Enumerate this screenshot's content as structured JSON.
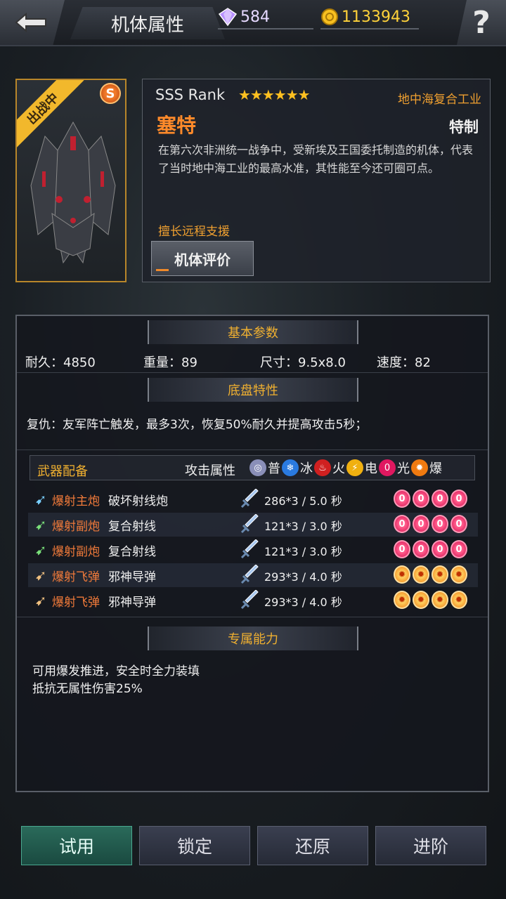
{
  "header": {
    "title": "机体属性",
    "gems": "584",
    "coins": "1133943",
    "help": "?"
  },
  "unit": {
    "deploy_status": "出战中",
    "rank_badge": "S",
    "rank": "SSS  Rank",
    "stars": "★★★★★★",
    "manufacturer": "地中海复合工业",
    "name": "塞特",
    "grade": "特制",
    "description": "在第六次非洲统一战争中，受新埃及王国委托制造的机体，代表了当时地中海工业的最高水准，其性能至今还可圈可点。",
    "specialty": "擅长远程支援",
    "eval_button": "机体评价"
  },
  "basic": {
    "header": "基本参数",
    "durability": "耐久：4850",
    "weight": "重量：89",
    "size": "尺寸：9.5x8.0",
    "speed": "速度：82"
  },
  "chassis": {
    "header": "底盘特性",
    "text": "复仇：友军阵亡触发，最多3次，恢复50%耐久并提高攻击5秒；"
  },
  "weapons": {
    "header": "武器配备",
    "attr_label": "攻击属性",
    "elements": [
      "普",
      "冰",
      "火",
      "电",
      "光",
      "爆"
    ],
    "rows": [
      {
        "type": "爆射主炮",
        "name": "破坏射线炮",
        "damage": "286*3  / 5.0 秒",
        "element": "light",
        "icon_color": "#7ad0ff"
      },
      {
        "type": "爆射副炮",
        "name": "复合射线",
        "damage": "121*3  / 3.0 秒",
        "element": "light",
        "icon_color": "#7ae07a"
      },
      {
        "type": "爆射副炮",
        "name": "复合射线",
        "damage": "121*3  / 3.0 秒",
        "element": "light",
        "icon_color": "#7ae07a"
      },
      {
        "type": "爆射飞弹",
        "name": "邪神导弹",
        "damage": "293*3  / 4.0 秒",
        "element": "burst",
        "icon_color": "#f0c080"
      },
      {
        "type": "爆射飞弹",
        "name": "邪神导弹",
        "damage": "293*3  / 4.0 秒",
        "element": "burst",
        "icon_color": "#f0c080"
      }
    ]
  },
  "exclusive": {
    "header": "专属能力",
    "line1": "可用爆发推进，安全时全力装填",
    "line2": "抵抗无属性伤害25%"
  },
  "buttons": {
    "trial": "试用",
    "lock": "锁定",
    "restore": "还原",
    "advance": "进阶"
  }
}
